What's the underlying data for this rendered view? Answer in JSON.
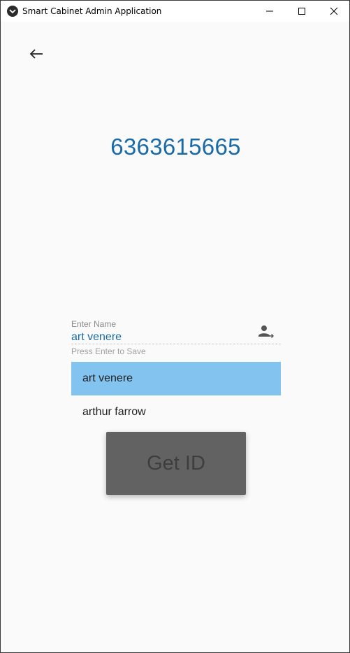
{
  "window": {
    "title": "Smart Cabinet Admin Application"
  },
  "main": {
    "id_number": "6363615665",
    "name_field": {
      "label": "Enter Name",
      "value": "art venere",
      "helper": "Press Enter to Save"
    },
    "suggestions": [
      {
        "label": "art venere",
        "selected": true
      },
      {
        "label": "arthur farrow",
        "selected": false
      }
    ],
    "get_id_label": "Get ID"
  },
  "colors": {
    "accent": "#1a6aa8",
    "selection": "#82c3f0",
    "button_bg": "#626262",
    "background": "#fafafa"
  },
  "icons": {
    "back": "arrow-left-icon",
    "person": "person-arrow-icon",
    "app": "app-icon"
  }
}
